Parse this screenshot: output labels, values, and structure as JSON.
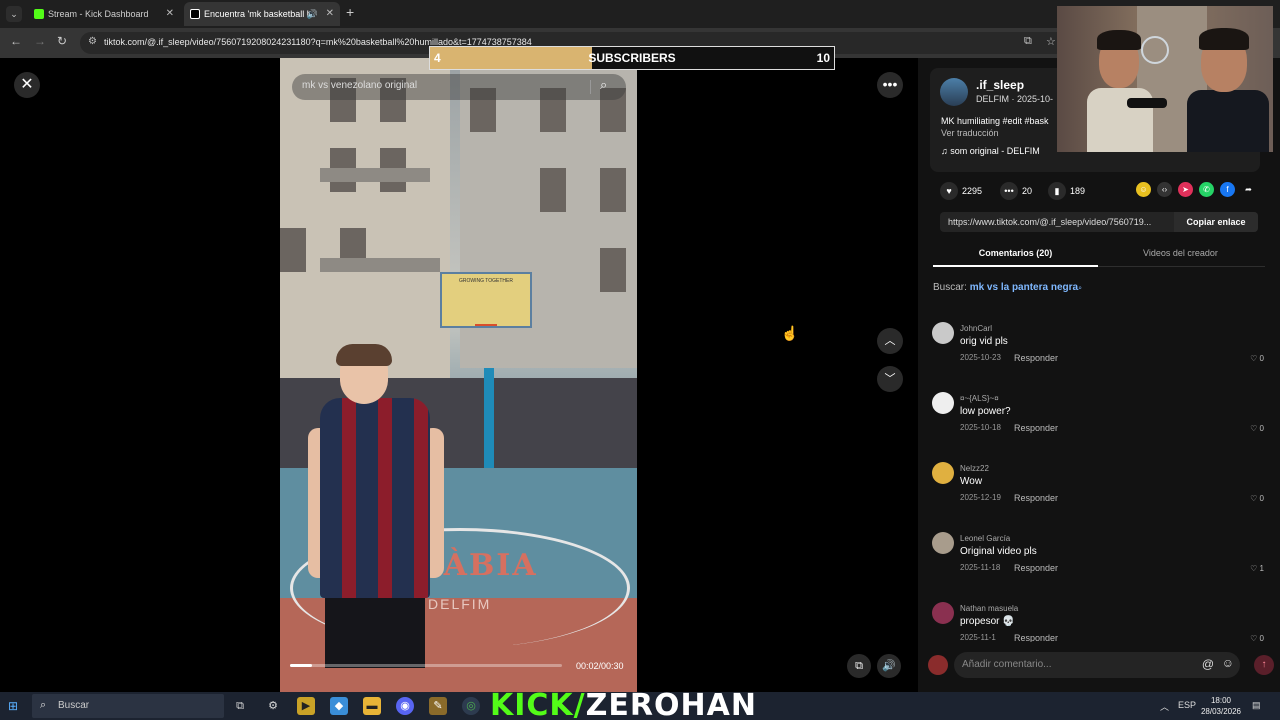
{
  "browser": {
    "tab_menu_icon": "chevron-down-icon",
    "tabs": [
      {
        "label": "Stream - Kick Dashboard",
        "favicon_color": "#53fc18"
      },
      {
        "label": "Encuentra 'mk basketball h",
        "favicon_color": "#ffffff"
      }
    ],
    "url": "tiktok.com/@.if_sleep/video/7560719208024231180?q=mk%20basketball%20humillado&t=1774738757384"
  },
  "overlay": {
    "subscribers": {
      "label": "SUBSCRIBERS",
      "current": "4",
      "goal": "10",
      "progress": 0.4
    }
  },
  "video": {
    "search_query": "mk vs venezolano original",
    "time": "00:02/00:30",
    "progress": 0.08,
    "wall_text": "GROWING TOGETHER",
    "court_text": "SÀBIA",
    "watermark": "DELFIM"
  },
  "post": {
    "username": ".if_sleep",
    "subline": "DELFIM · 2025-10-",
    "caption": "MK humiliating #edit #bask",
    "translate": "Ver traducción",
    "music": "som original - DELFIM",
    "likes": "2295",
    "comments_count": "20",
    "saves": "189",
    "link": "https://www.tiktok.com/@.if_sleep/video/7560719...",
    "copy_label": "Copiar enlace"
  },
  "panel_tabs": [
    {
      "label": "Comentarios (20)",
      "active": true
    },
    {
      "label": "Videos del creador",
      "active": false
    }
  ],
  "search_suggest": {
    "prefix": "Buscar:",
    "query": "mk vs la pantera negra"
  },
  "reply_label": "Responder",
  "comments": [
    {
      "user": "JohnCarl",
      "text": "orig vid pls",
      "date": "2025-10-23",
      "likes": "0",
      "avatar_color": "#c9c9c9"
    },
    {
      "user": "¤~{ALS}~¤",
      "text": "low power?",
      "date": "2025-10-18",
      "likes": "0",
      "avatar_color": "#eeeeee"
    },
    {
      "user": "Nelzz22",
      "text": "Wow",
      "date": "2025-12-19",
      "likes": "0",
      "avatar_color": "#e0b040"
    },
    {
      "user": "Leonel García",
      "text": "Original video pls",
      "date": "2025-11-18",
      "likes": "1",
      "avatar_color": "#a89c8c"
    },
    {
      "user": "Nathan masuela",
      "text": "propesor 💀",
      "date": "2025-11-1",
      "likes": "0",
      "avatar_color": "#8a3050"
    }
  ],
  "comment_input": {
    "placeholder": "Añadir comentario..."
  },
  "taskbar": {
    "search_label": "Buscar",
    "kick_prefix": "KICK/",
    "kick_channel": "ZEROHAN",
    "lang": "ESP",
    "time": "18:00",
    "date": "28/03/2026"
  }
}
